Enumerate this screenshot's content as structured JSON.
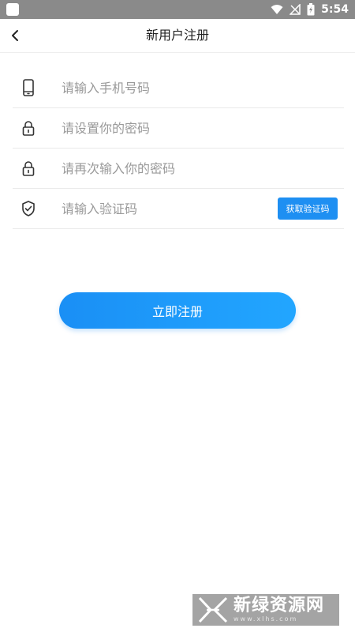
{
  "status_bar": {
    "time": "5:54"
  },
  "header": {
    "title": "新用户注册",
    "back_icon": "chevron-left-icon"
  },
  "form": {
    "phone": {
      "icon": "phone-icon",
      "placeholder": "请输入手机号码",
      "value": ""
    },
    "password": {
      "icon": "lock-icon",
      "placeholder": "请设置你的密码",
      "value": ""
    },
    "confirm_password": {
      "icon": "lock-icon",
      "placeholder": "请再次输入你的密码",
      "value": ""
    },
    "verify_code": {
      "icon": "shield-check-icon",
      "placeholder": "请输入验证码",
      "value": "",
      "button_label": "获取验证码"
    }
  },
  "register_button": {
    "label": "立即注册"
  },
  "watermark": {
    "text": "新绿资源网",
    "sub": "www.xlhs.com"
  },
  "colors": {
    "accent": "#1e8ff2",
    "placeholder": "#9a9a9a",
    "status_bar": "#8a8a8a"
  }
}
